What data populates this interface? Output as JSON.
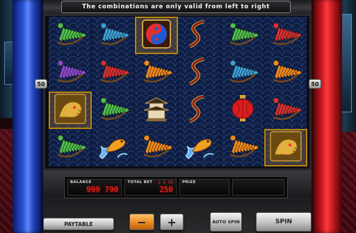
{
  "banner": {
    "text": "The combinations are only valid from left to right"
  },
  "reels": {
    "line_marker_left": "50",
    "line_marker_right": "50",
    "grid": [
      [
        "fan-green",
        "fan-blue",
        "yin-yang",
        "dragon",
        "fan-green",
        "fan-red"
      ],
      [
        "fan-purple",
        "fan-red",
        "fan-orange",
        "dragon",
        "fan-blue",
        "fan-orange"
      ],
      [
        "golden-dragon",
        "fan-green",
        "pagoda",
        "dragon",
        "lantern",
        "fan-red"
      ],
      [
        "fan-green",
        "koi",
        "fan-orange",
        "koi",
        "fan-orange",
        "golden-dragon"
      ]
    ],
    "highlighted": [
      [
        2,
        0
      ],
      [
        3,
        5
      ],
      [
        0,
        2
      ]
    ]
  },
  "panel": {
    "balance_label": "BALANCE",
    "balance_value": "999 790",
    "total_bet_label": "TOTAL BET",
    "total_bet_value": "250",
    "total_bet_lines": "5 X 50",
    "prize_label": "PRIZE",
    "prize_value": ""
  },
  "buttons": {
    "paytable": "PAYTABLE",
    "minus": "−",
    "plus": "+",
    "auto_spin": "AUTO SPIN",
    "spin": "SPIN"
  },
  "colors": {
    "fan-green": "#4fbf4a",
    "fan-blue": "#3aa0d8",
    "fan-red": "#d83030",
    "fan-orange": "#f08a1c",
    "fan-purple": "#8a4ad0",
    "meter_text": "#ff2a1a"
  }
}
